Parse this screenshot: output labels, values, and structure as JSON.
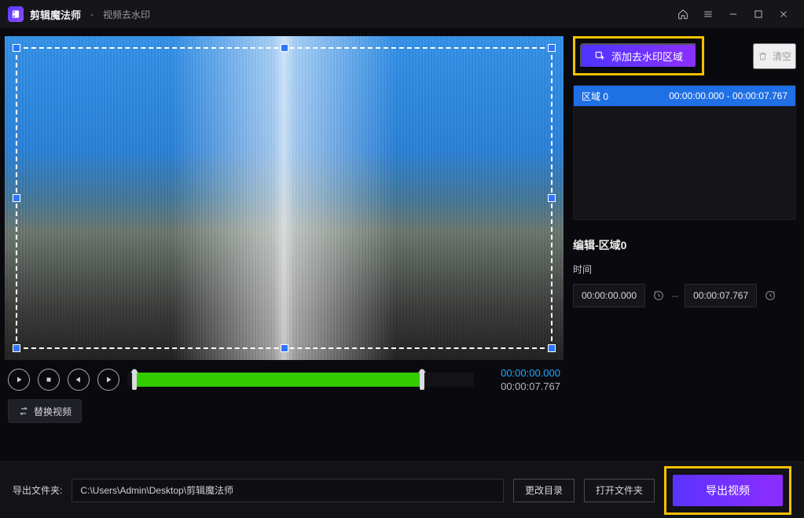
{
  "app": {
    "name": "剪辑魔法师",
    "separator": " - ",
    "module": "视频去水印"
  },
  "window_buttons": {
    "home": "home",
    "menu": "menu",
    "min": "min",
    "max": "max",
    "close": "close"
  },
  "player": {
    "current_time": "00:00:00.000",
    "duration": "00:00:07.767",
    "replace_label": "替换视频"
  },
  "sidebar": {
    "add_label": "添加去水印区域",
    "clear_label": "清空",
    "regions": [
      {
        "name": "区域 0",
        "range": "00:00:00.000 - 00:00:07.767",
        "active": true
      }
    ],
    "edit": {
      "title": "编辑-区域0",
      "time_label": "时间",
      "from": "00:00:00.000",
      "to": "00:00:07.767",
      "sep": "--"
    }
  },
  "bottom": {
    "label": "导出文件夹:",
    "path": "C:\\Users\\Admin\\Desktop\\剪辑魔法师",
    "change_dir": "更改目录",
    "open_dir": "打开文件夹",
    "export": "导出视频"
  },
  "colors": {
    "accent": "#7a2cff",
    "highlight": "#f4c100",
    "green": "#33cc00",
    "cyan": "#1fa8ff",
    "region_active": "#1f6fe5"
  }
}
